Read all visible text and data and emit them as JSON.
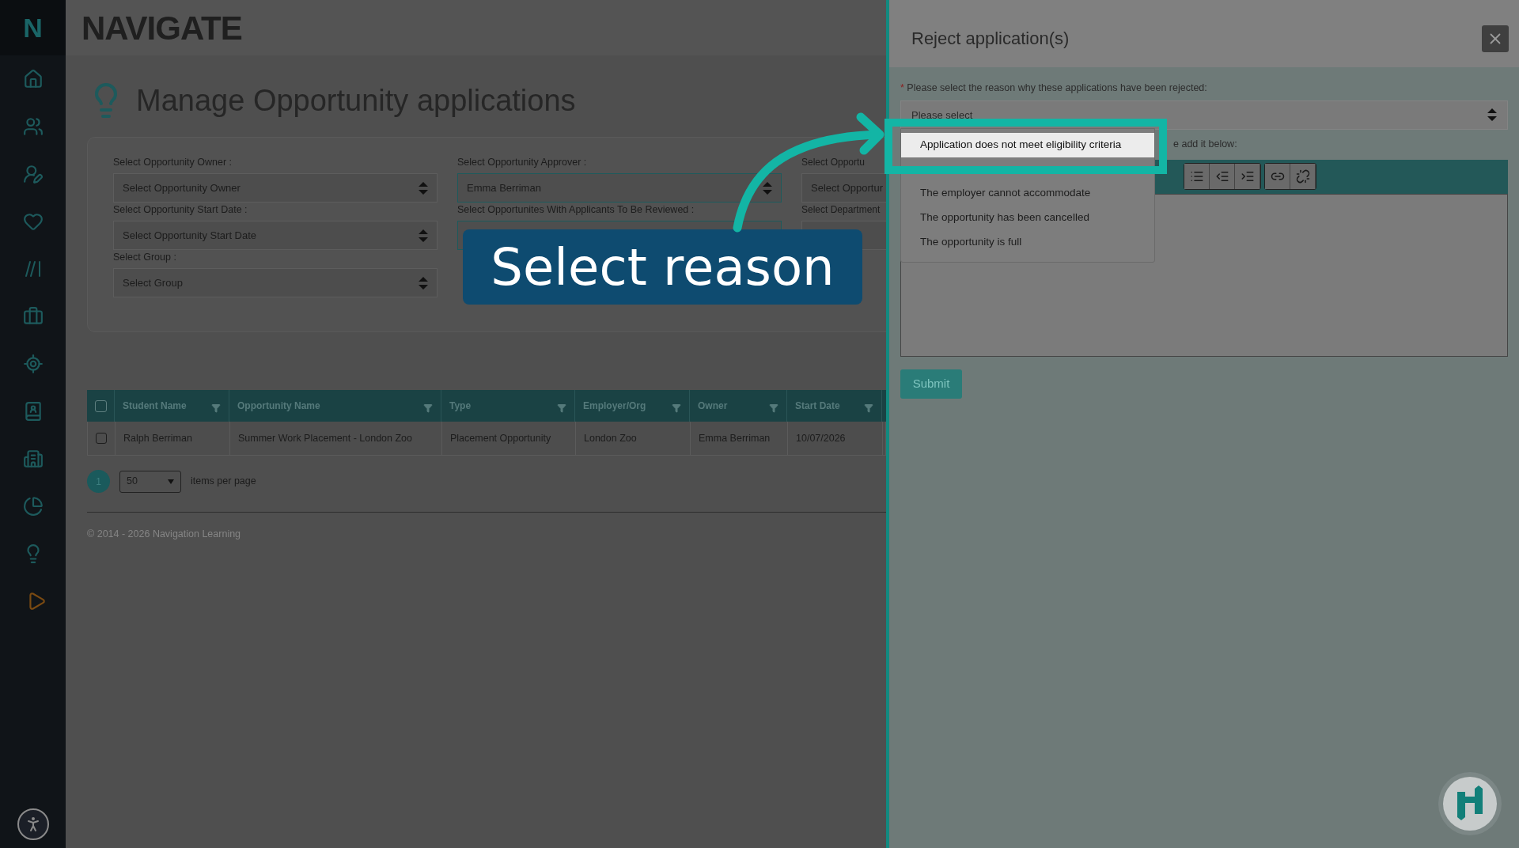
{
  "sidebar": {
    "logo": "N"
  },
  "header": {
    "logo": "NAVIGATE"
  },
  "page": {
    "title": "Manage Opportunity applications"
  },
  "filters": [
    {
      "label": "Select Opportunity Owner :",
      "value": "Select Opportunity Owner"
    },
    {
      "label": "Select Opportunity Approver :",
      "value": "Emma Berriman"
    },
    {
      "label": "Select Opportu",
      "value": "Select Opportur"
    },
    {
      "label": "Select Opportunity Start Date :",
      "value": "Select Opportunity Start Date"
    },
    {
      "label": "Select Opportunites With Applicants To Be Reviewed :"
    },
    {
      "label": "Select Department"
    },
    {
      "label": "Select Group :",
      "value": "Select Group"
    }
  ],
  "table": {
    "all_checked": false,
    "columns": [
      "Student Name",
      "Opportunity Name",
      "Type",
      "Employer/Org",
      "Owner",
      "Start Date"
    ],
    "rows": [
      {
        "checked": false,
        "cells": [
          "Ralph Berriman",
          "Summer Work Placement - London Zoo",
          "Placement Opportunity",
          "London Zoo",
          "Emma Berriman",
          "10/07/2026"
        ]
      }
    ]
  },
  "pagination": {
    "pages": [
      {
        "label": "1",
        "selected": true
      }
    ],
    "per_page": "50",
    "per_page_label": "items per page"
  },
  "footer": "© 2014 - 2026 Navigation Learning",
  "dialog": {
    "title": "Reject application(s)",
    "required_mark": "*",
    "reason_label": "Please select the reason why these applications have been rejected:",
    "reason_select": {
      "placeholder": "Please select"
    },
    "options": [
      {
        "label": "Application does not meet eligibility criteria",
        "selected": true
      },
      {
        "label": "The employer cannot accommodate",
        "selected": false
      },
      {
        "label": "The opportunity has been cancelled",
        "selected": false
      },
      {
        "label": "The opportunity is full",
        "selected": false
      }
    ],
    "notes_hint": "e add it below:",
    "submit": "Submit"
  },
  "annotation": {
    "callout": "Select reason"
  }
}
